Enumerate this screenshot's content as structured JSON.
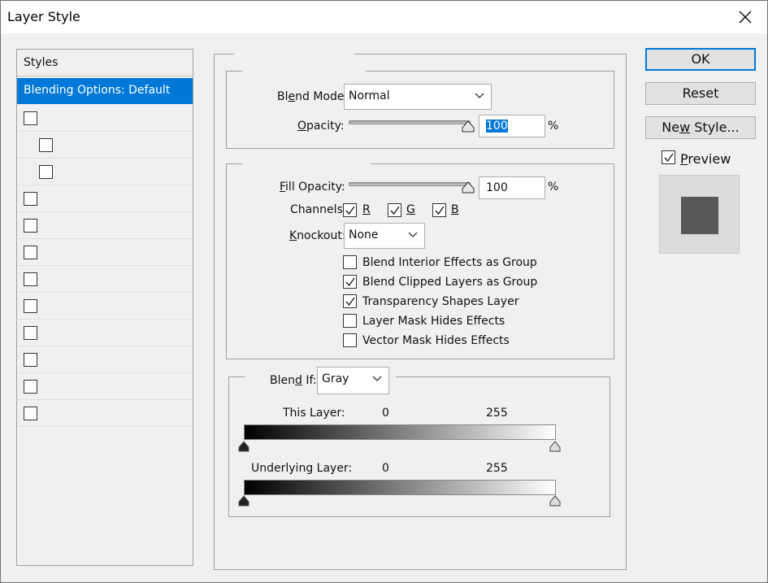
{
  "window": {
    "title": "Layer Style"
  },
  "styles_panel": {
    "header": "Styles",
    "selected": "Blending Options: Default",
    "items": [
      {
        "checked": false,
        "indent": false
      },
      {
        "checked": false,
        "indent": true
      },
      {
        "checked": false,
        "indent": true
      },
      {
        "checked": false,
        "indent": false
      },
      {
        "checked": false,
        "indent": false
      },
      {
        "checked": false,
        "indent": false
      },
      {
        "checked": false,
        "indent": false
      },
      {
        "checked": false,
        "indent": false
      },
      {
        "checked": false,
        "indent": false
      },
      {
        "checked": false,
        "indent": false
      },
      {
        "checked": false,
        "indent": false
      },
      {
        "checked": false,
        "indent": false
      }
    ]
  },
  "general": {
    "blend_mode_label": "Blend Mode:",
    "blend_mode_value": "Normal",
    "opacity_label": "Opacity:",
    "opacity_value": "100",
    "opacity_unit": "%",
    "opacity_level": 1.0
  },
  "advanced": {
    "fill_opacity_label": "Fill Opacity:",
    "fill_opacity_value": "100",
    "fill_opacity_unit": "%",
    "fill_opacity_level": 1.0,
    "channels_label": "Channels:",
    "channels": [
      {
        "label": "R",
        "checked": true
      },
      {
        "label": "G",
        "checked": true
      },
      {
        "label": "B",
        "checked": true
      }
    ],
    "knockout_label": "Knockout:",
    "knockout_value": "None",
    "options": [
      {
        "label": "Blend Interior Effects as Group",
        "checked": false
      },
      {
        "label": "Blend Clipped Layers as Group",
        "checked": true
      },
      {
        "label": "Transparency Shapes Layer",
        "checked": true
      },
      {
        "label": "Layer Mask Hides Effects",
        "checked": false
      },
      {
        "label": "Vector Mask Hides Effects",
        "checked": false
      }
    ]
  },
  "blend_if": {
    "label": "Blend If:",
    "value": "Gray",
    "this_layer_label": "This Layer:",
    "this_layer_min": "0",
    "this_layer_max": "255",
    "underlying_label": "Underlying Layer:",
    "underlying_min": "0",
    "underlying_max": "255"
  },
  "buttons": {
    "ok": "OK",
    "reset": "Reset",
    "new_style": "New Style..."
  },
  "preview": {
    "label": "Preview",
    "checked": true,
    "swatch_color": "#585858"
  },
  "colors": {
    "accent": "#0078d7",
    "background": "#f0f0f0"
  }
}
